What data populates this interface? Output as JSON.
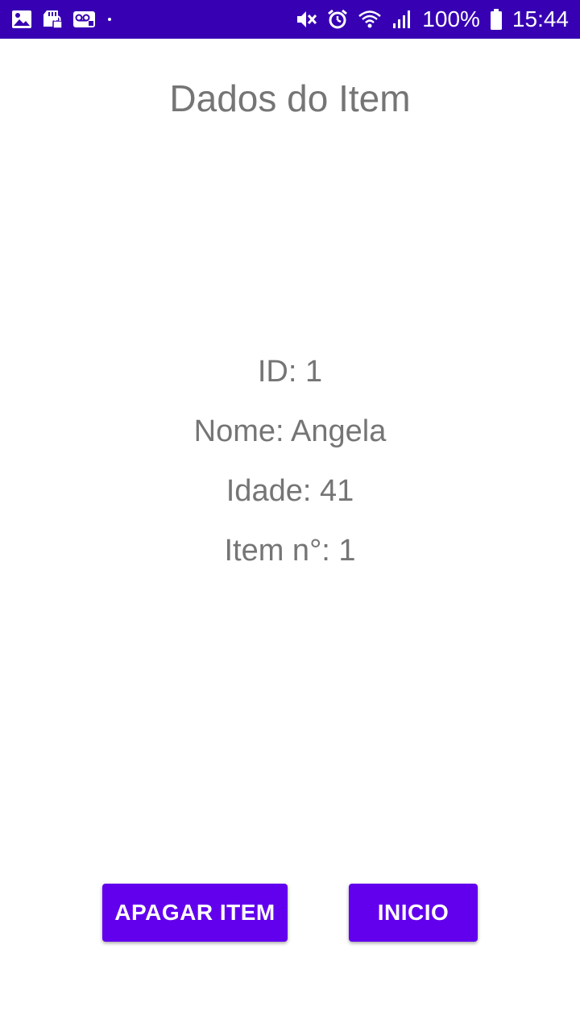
{
  "status_bar": {
    "background_color": "#3700b3",
    "left_icons": [
      "gallery-icon",
      "sd-card-lock-icon",
      "voicemail-icon",
      "dot-indicator"
    ],
    "right_icons": [
      "mute-icon",
      "alarm-icon",
      "wifi-icon",
      "signal-icon",
      "battery-icon"
    ],
    "battery_percent": "100%",
    "time": "15:44"
  },
  "page": {
    "title": "Dados do Item"
  },
  "item": {
    "id_line": "ID: 1",
    "name_line": "Nome: Angela",
    "age_line": "Idade: 41",
    "number_line": "Item n°: 1"
  },
  "buttons": {
    "delete_label": "APAGAR ITEM",
    "home_label": "INICIO",
    "color": "#6200ee"
  }
}
